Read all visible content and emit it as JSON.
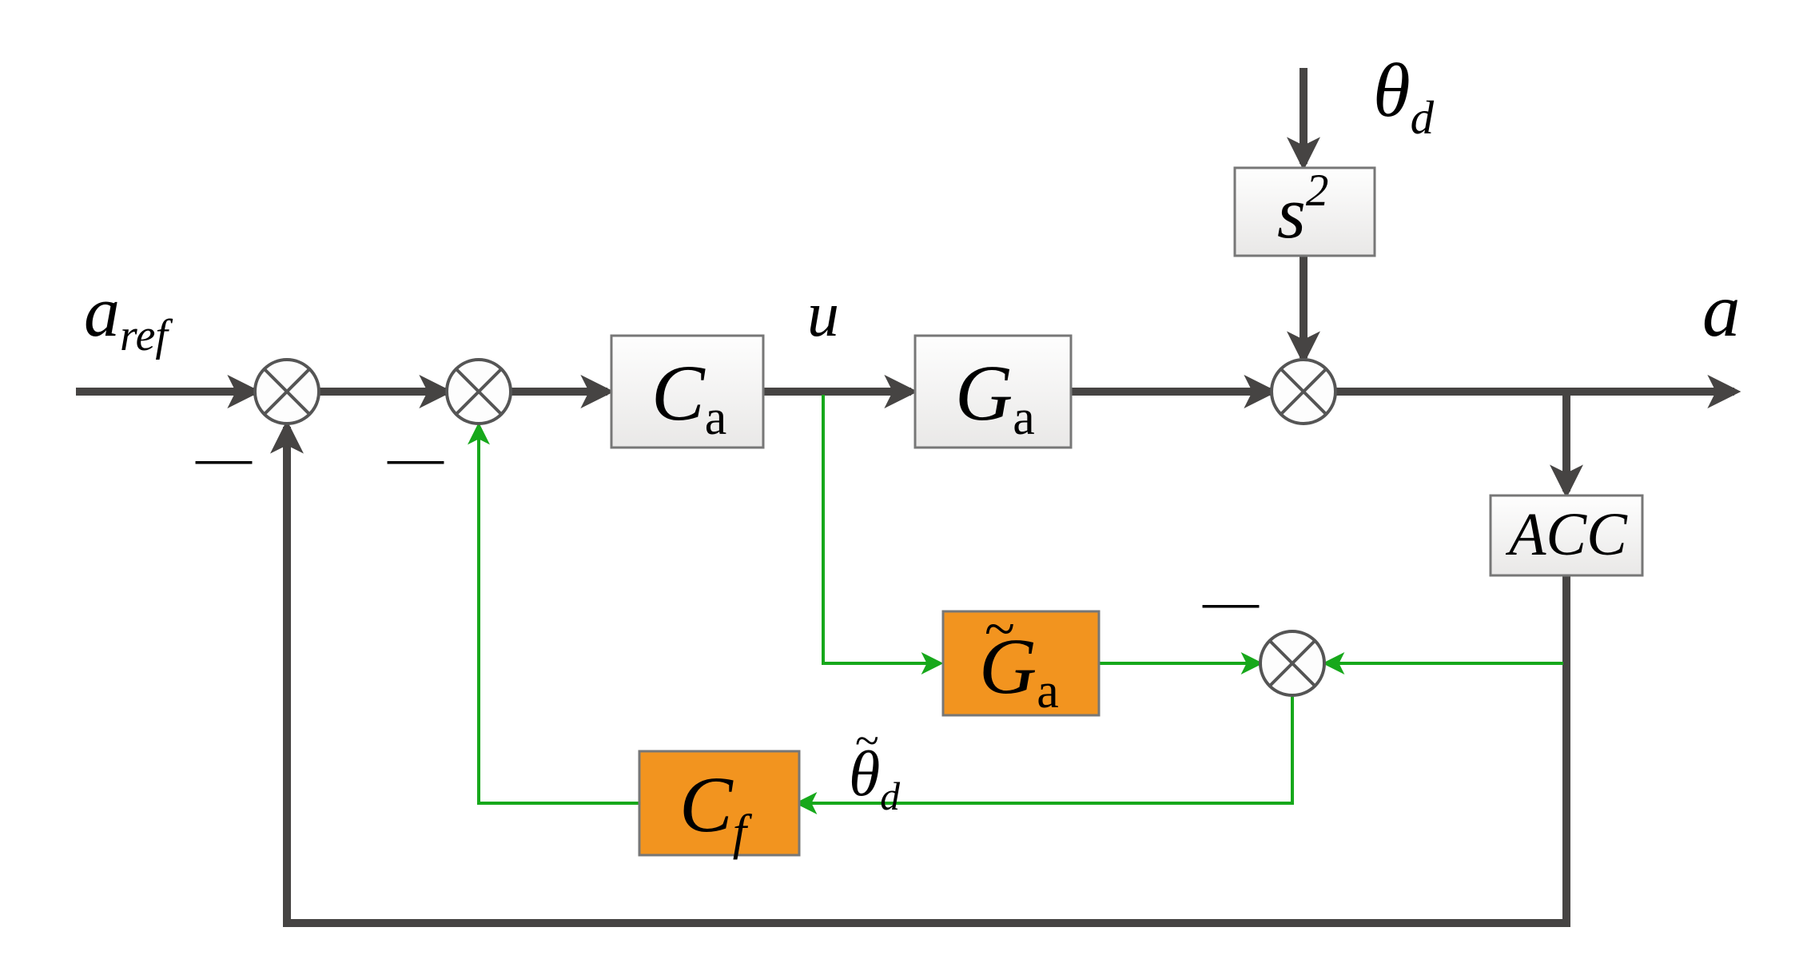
{
  "diagram": {
    "type": "control-block-diagram",
    "description": "Disturbance observer / feedforward compensation control loop",
    "labels": {
      "input_ref": "a",
      "input_ref_sub": "ref",
      "output": "a",
      "disturbance": "θ",
      "disturbance_sub": "d",
      "estimated_disturbance": "θ",
      "estimated_disturbance_sub": "d",
      "control_signal": "u"
    },
    "blocks": {
      "controller": {
        "main": "C",
        "sub": "a"
      },
      "plant": {
        "main": "G",
        "sub": "a"
      },
      "plant_model": {
        "main": "G",
        "sub": "a",
        "tilde": true
      },
      "feedforward": {
        "main": "C",
        "sub": "f",
        "tilde": false
      },
      "sensor": {
        "main": "ACC"
      },
      "s_squared": {
        "main": "s",
        "sup": "2"
      }
    },
    "summing_junctions": {
      "outer_error": {
        "signs": [
          "+",
          "−"
        ]
      },
      "inner_error": {
        "signs": [
          "+",
          "−"
        ]
      },
      "disturbance_add": {
        "signs": [
          "+",
          "+"
        ]
      },
      "estimation_error": {
        "signs": [
          "+",
          "−"
        ]
      }
    },
    "signal_paths": {
      "forward_main": "dark",
      "outer_feedback": "dark",
      "observer_loop": "green"
    },
    "colors": {
      "dark_line": "#464443",
      "green_line": "#17a81b",
      "orange_block": "#f2941f",
      "white_block": "#f4f3f2"
    }
  }
}
